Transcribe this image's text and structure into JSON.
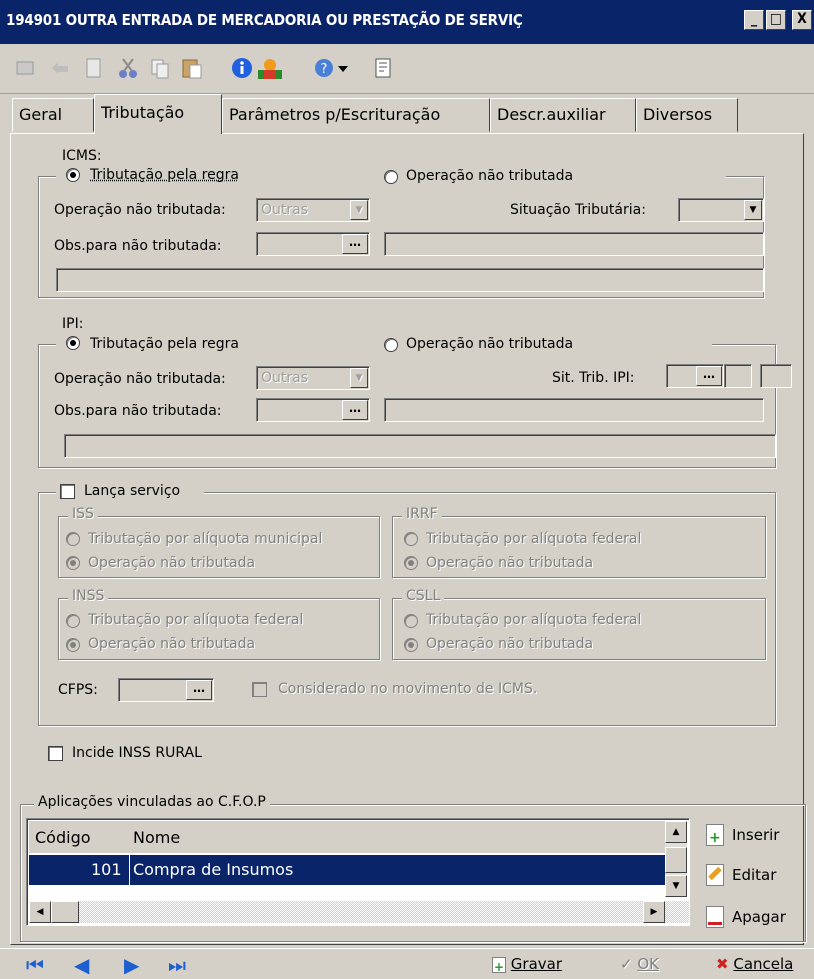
{
  "window": {
    "title": "194901 OUTRA ENTRADA DE MERCADORIA OU PRESTAÇÃO DE SERVIÇ",
    "min": "_",
    "max": "□",
    "close": "X"
  },
  "toolbar": {
    "icons": [
      "edit-icon",
      "undo-icon",
      "new-doc-icon",
      "cut-icon",
      "copy-icon",
      "paste-icon",
      "info-icon",
      "user-icon",
      "help-icon",
      "dropdown-arrow-icon",
      "print-preview-icon"
    ]
  },
  "tabs": [
    {
      "label": "Geral"
    },
    {
      "label": "Tributação"
    },
    {
      "label": "Parâmetros p/Escrituração"
    },
    {
      "label": "Descr.auxiliar"
    },
    {
      "label": "Diversos"
    }
  ],
  "icms": {
    "legend": "ICMS:",
    "radio_regra": "Tributação pela regra",
    "radio_nao": "Operação não tributada",
    "op_nao_trib_label": "Operação não tributada:",
    "op_nao_trib_value": "Outras",
    "sit_trib_label": "Situação Tributária:",
    "obs_label": "Obs.para não tributada:"
  },
  "ipi": {
    "legend": "IPI:",
    "radio_regra": "Tributação pela regra",
    "radio_nao": "Operação não tributada",
    "op_nao_trib_label": "Operação não tributada:",
    "op_nao_trib_value": "Outras",
    "sit_trib_label": "Sit. Trib. IPI:",
    "obs_label": "Obs.para não tributada:"
  },
  "servico": {
    "checkbox_label": "Lança serviço",
    "iss": {
      "legend": "ISS",
      "opt1": "Tributação por alíquota municipal",
      "opt2": "Operação não tributada"
    },
    "irrf": {
      "legend": "IRRF",
      "opt1": "Tributação por alíquota federal",
      "opt2": "Operação não tributada"
    },
    "inss": {
      "legend": "INSS",
      "opt1": "Tributação por alíquota federal",
      "opt2": "Operação não tributada"
    },
    "csll": {
      "legend": "CSLL",
      "opt1": "Tributação por alíquota federal",
      "opt2": "Operação não tributada"
    },
    "cfps_label": "CFPS:",
    "considerado_label": "Considerado no movimento de ICMS."
  },
  "inss_rural_label": "Incide INSS RURAL",
  "aplicacoes": {
    "legend": "Aplicações vinculadas ao C.F.O.P",
    "columns": [
      "Código",
      "Nome"
    ],
    "rows": [
      {
        "codigo": "101",
        "nome": "Compra de Insumos"
      }
    ],
    "inserir": "Inserir",
    "editar": "Editar",
    "apagar": "Apagar"
  },
  "bottom": {
    "gravar": "Gravar",
    "ok": "OK",
    "cancelar": "Cancela"
  }
}
